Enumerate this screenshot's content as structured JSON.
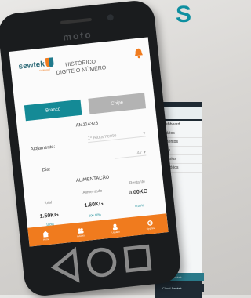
{
  "background": {
    "corner_text": "S"
  },
  "phone": {
    "brand": "moto",
    "app": {
      "logo": "sewtek",
      "logo_sub": "CONSULT",
      "title_line1": "HISTÓRICO",
      "title_line2": "DIGITE O NÚMERO",
      "tabs": [
        {
          "label": "Branco",
          "active": true
        },
        {
          "label": "Chipe",
          "active": false
        }
      ],
      "code": "AM114328",
      "alojamento_label": "Alojamento:",
      "alojamento_value": "1º Alojamento",
      "dia_label": "Dia:",
      "dia_value": "47",
      "section": "ALIMENTAÇÃO",
      "columns": [
        {
          "label": "Total",
          "value": "1.50KG",
          "pct": "100%"
        },
        {
          "label": "Alimentado",
          "value": "1.60KG",
          "pct": "106.00%"
        },
        {
          "label": "Restante",
          "value": "0.00KG",
          "pct": "0.00%"
        }
      ],
      "nav": [
        {
          "label": "Home",
          "icon": "home-icon"
        },
        {
          "label": "Aviários",
          "icon": "group-icon"
        },
        {
          "label": "Usuário",
          "icon": "user-icon"
        },
        {
          "label": "Opções",
          "icon": "gear-icon"
        }
      ]
    }
  },
  "laptop": {
    "menu": [
      "Dashboard",
      "Aviários",
      "Alimentos",
      "Lotes",
      "Usuários",
      "Relatórios"
    ],
    "footer": [
      "Cloud Sewtek",
      "Cloud Sewtek"
    ]
  },
  "colors": {
    "accent": "#148a96",
    "nav": "#f07b1e"
  }
}
